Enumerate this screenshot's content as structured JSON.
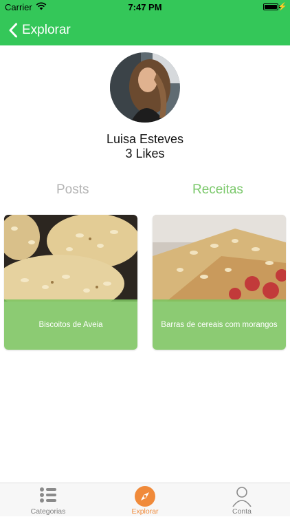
{
  "status_bar": {
    "carrier": "Carrier",
    "time": "7:47 PM",
    "icons": [
      "wifi-icon",
      "battery-icon",
      "charging-bolt-icon"
    ]
  },
  "nav": {
    "back_label": "Explorar",
    "back_icon": "chevron-left-icon"
  },
  "profile": {
    "name": "Luisa Esteves",
    "likes": "3 Likes"
  },
  "tabs": [
    {
      "label": "Posts",
      "selected": false
    },
    {
      "label": "Receitas",
      "selected": true
    }
  ],
  "recipes": [
    {
      "title": "Biscoitos de Aveia"
    },
    {
      "title": "Barras de cereais com morangos"
    }
  ],
  "tab_bar": {
    "items": [
      {
        "label": "Categorias",
        "icon": "list-icon",
        "active": false
      },
      {
        "label": "Explorar",
        "icon": "compass-icon",
        "active": true
      },
      {
        "label": "Conta",
        "icon": "user-icon",
        "active": false
      }
    ]
  },
  "colors": {
    "brand_green": "#34c759",
    "card_overlay": "#7cc460",
    "active_tab_text": "#7ac86a",
    "inactive_tab_text": "#b3b3b3",
    "tab_bar_active": "#f08a3a",
    "tab_bar_inactive": "#7f7f7f"
  }
}
